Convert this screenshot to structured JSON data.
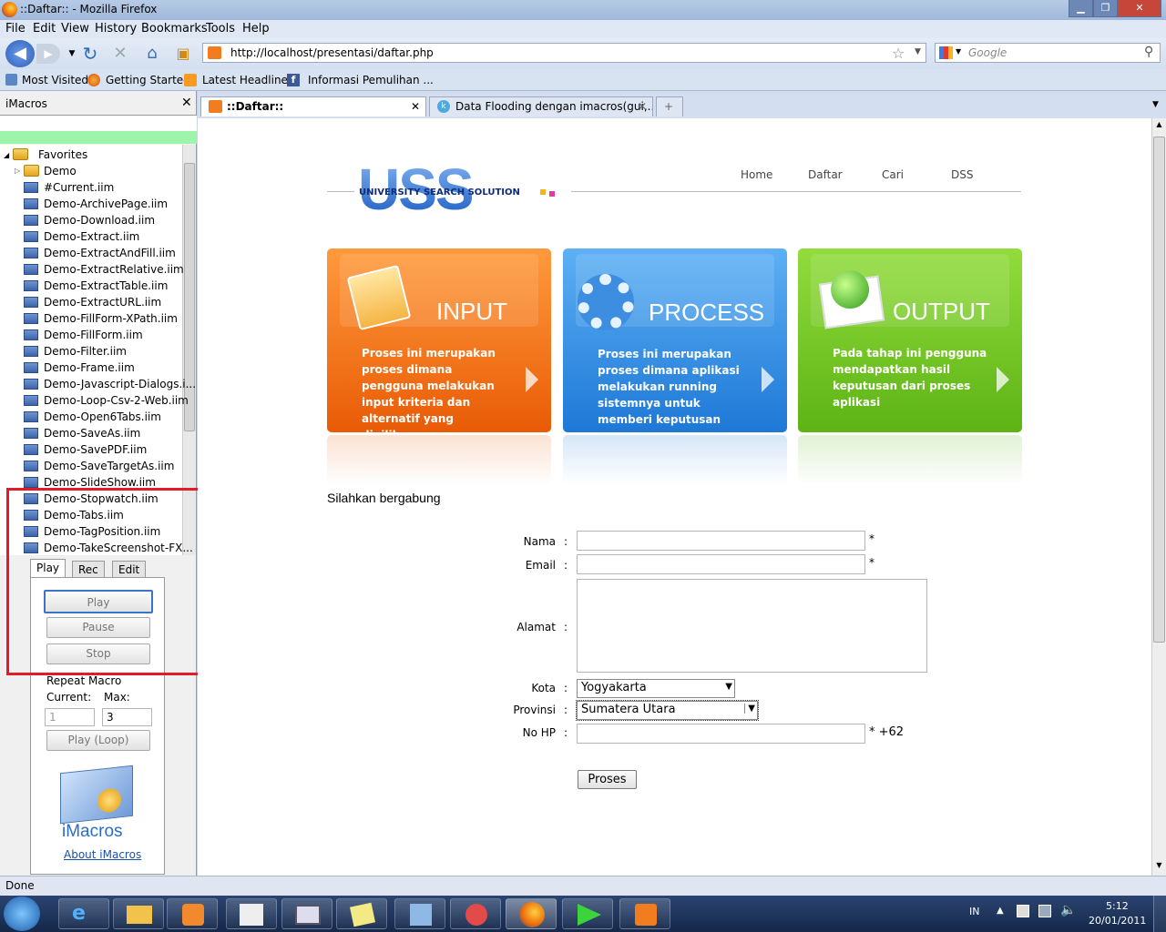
{
  "window": {
    "title": "::Daftar:: - Mozilla Firefox"
  },
  "menu": [
    "File",
    "Edit",
    "View",
    "History",
    "Bookmarks",
    "Tools",
    "Help"
  ],
  "url": "http://localhost/presentasi/daftar.php",
  "search_placeholder": "Google",
  "bookmarks": [
    "Most Visited",
    "Getting Started",
    "Latest Headlines",
    "Informasi Pemulihan ..."
  ],
  "sidebar": {
    "title": "iMacros",
    "tree_root": "Favorites",
    "folder": "Demo",
    "files": [
      "#Current.iim",
      "Demo-ArchivePage.iim",
      "Demo-Download.iim",
      "Demo-Extract.iim",
      "Demo-ExtractAndFill.iim",
      "Demo-ExtractRelative.iim",
      "Demo-ExtractTable.iim",
      "Demo-ExtractURL.iim",
      "Demo-FillForm-XPath.iim",
      "Demo-FillForm.iim",
      "Demo-Filter.iim",
      "Demo-Frame.iim",
      "Demo-Javascript-Dialogs.i...",
      "Demo-Loop-Csv-2-Web.iim",
      "Demo-Open6Tabs.iim",
      "Demo-SaveAs.iim",
      "Demo-SavePDF.iim",
      "Demo-SaveTargetAs.iim",
      "Demo-SlideShow.iim",
      "Demo-Stopwatch.iim",
      "Demo-Tabs.iim",
      "Demo-TagPosition.iim",
      "Demo-TakeScreenshot-FX..."
    ],
    "tabs": [
      "Play",
      "Rec",
      "Edit"
    ],
    "buttons": {
      "play": "Play",
      "pause": "Pause",
      "stop": "Stop",
      "loop": "Play (Loop)"
    },
    "repeat_label": "Repeat Macro",
    "current_label": "Current:",
    "max_label": "Max:",
    "current_value": "1",
    "max_value": "3",
    "logo_text": "iMacros",
    "about": "About iMacros"
  },
  "tabs": [
    {
      "label": "::Daftar::"
    },
    {
      "label": "Data Flooding dengan imacros(gui,..."
    }
  ],
  "page": {
    "logo_text": "USS",
    "logo_sub": "UNIVERSITY SEARCH SOLUTION",
    "nav": [
      "Home",
      "Daftar",
      "Cari",
      "DSS"
    ],
    "cards": [
      {
        "title": "INPUT",
        "text": "Proses ini merupakan proses dimana pengguna melakukan input kriteria dan alternatif yang dipilihnya",
        "color": "#f26b0c"
      },
      {
        "title": "PROCESS",
        "text": "Proses ini merupakan proses dimana aplikasi melakukan running sistemnya untuk memberi keputusan",
        "color": "#2d8fe0"
      },
      {
        "title": "OUTPUT",
        "text": "Pada tahap ini pengguna mendapatkan hasil keputusan dari proses aplikasi",
        "color": "#6fc81b"
      }
    ],
    "heading": "Silahkan bergabung",
    "form": {
      "nama": "Nama",
      "email": "Email",
      "alamat": "Alamat",
      "kota": "Kota",
      "provinsi": "Provinsi",
      "nohp": "No HP",
      "colon": ":",
      "required": "*",
      "phone_prefix": "* +62",
      "kota_value": "Yogyakarta",
      "provinsi_value": "Sumatera Utara",
      "submit": "Proses"
    }
  },
  "status": "Done",
  "taskbar": {
    "lang": "IN",
    "time": "5:12",
    "date": "20/01/2011"
  }
}
